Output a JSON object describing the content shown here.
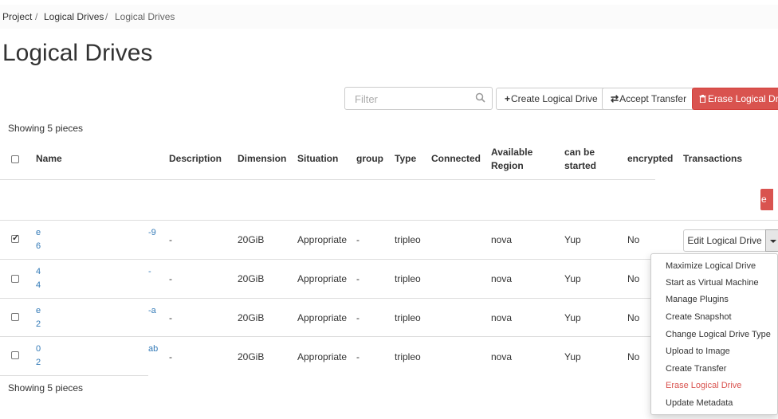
{
  "breadcrumb": {
    "items": [
      "Project",
      "Logical Drives",
      "Logical Drives"
    ],
    "sep": "/"
  },
  "page_title": "Logical Drives",
  "toolbar": {
    "filter_placeholder": "Filter",
    "create_label": "Create Logical Drive",
    "accept_label": "Accept Transfer",
    "erase_label": "Erase Logical Drive",
    "create_icon": "+",
    "accept_icon": "⇄",
    "erase_icon": "🗑"
  },
  "count_top": "Showing 5 pieces",
  "count_bottom": "Showing 5 pieces",
  "table": {
    "headers": {
      "name": "Name",
      "description": "Description",
      "dimension": "Dimension",
      "situation": "Situation",
      "group": "group",
      "type": "Type",
      "connected": "Connected",
      "available_region_1": "Available",
      "available_region_2": "Region",
      "can_be_started_1": "can be",
      "can_be_started_2": "started",
      "encrypted": "encrypted",
      "transactions": "Transactions"
    },
    "partial_button_text": "e",
    "rows": [
      {
        "checked": true,
        "name_a": "e",
        "name_b": "6",
        "name_tail": "-9",
        "description": "-",
        "dimension": "20GiB",
        "situation": "Appropriate",
        "group": "-",
        "type": "tripleo",
        "region": "nova",
        "started": "Yup",
        "encrypted": "No"
      },
      {
        "checked": false,
        "name_a": "4",
        "name_b": "4",
        "name_tail": "-",
        "description": "-",
        "dimension": "20GiB",
        "situation": "Appropriate",
        "group": "-",
        "type": "tripleo",
        "region": "nova",
        "started": "Yup",
        "encrypted": "No"
      },
      {
        "checked": false,
        "name_a": "e",
        "name_b": "2",
        "name_tail": "-a",
        "description": "-",
        "dimension": "20GiB",
        "situation": "Appropriate",
        "group": "-",
        "type": "tripleo",
        "region": "nova",
        "started": "Yup",
        "encrypted": "No"
      },
      {
        "checked": false,
        "name_a": "0",
        "name_b": "2",
        "name_tail": "ab",
        "description": "-",
        "dimension": "20GiB",
        "situation": "Appropriate",
        "group": "-",
        "type": "tripleo",
        "region": "nova",
        "started": "Yup",
        "encrypted": "No"
      }
    ],
    "edit_button": "Edit Logical Drive"
  },
  "actions_menu": [
    "Maximize Logical Drive",
    "Start as Virtual Machine",
    "Manage Plugins",
    "Create Snapshot",
    "Change Logical Drive Type",
    "Upload to Image",
    "Create Transfer",
    "Erase Logical Drive",
    "Update Metadata"
  ],
  "colors": {
    "link": "#337ab7",
    "danger": "#d9534f"
  }
}
